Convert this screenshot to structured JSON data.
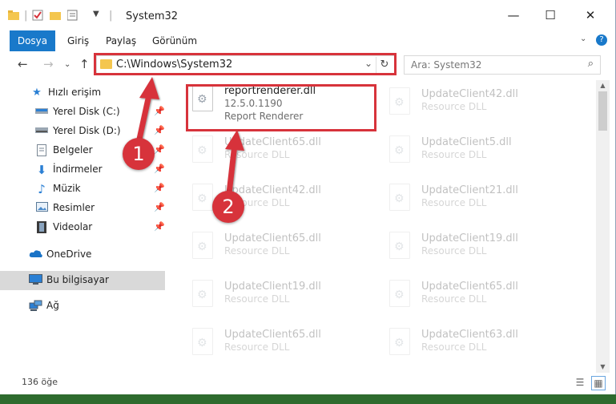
{
  "window": {
    "title": "System32",
    "controls": {
      "minimize": "—",
      "maximize": "☐",
      "close": "✕"
    }
  },
  "ribbon": {
    "tabs": [
      {
        "label": "Dosya"
      },
      {
        "label": "Giriş"
      },
      {
        "label": "Paylaş"
      },
      {
        "label": "Görünüm"
      }
    ]
  },
  "address": {
    "path": "C:\\Windows\\System32",
    "search_placeholder": "Ara: System32"
  },
  "sidebar": {
    "quick_access": "Hızlı erişim",
    "items": [
      {
        "label": "Yerel Disk (C:)"
      },
      {
        "label": "Yerel Disk (D:)"
      },
      {
        "label": "Belgeler"
      },
      {
        "label": "İndirmeler"
      },
      {
        "label": "Müzik"
      },
      {
        "label": "Resimler"
      },
      {
        "label": "Videolar"
      }
    ],
    "onedrive": "OneDrive",
    "this_pc": "Bu bilgisayar",
    "network": "Ağ"
  },
  "files": {
    "highlighted": {
      "name": "reportrenderer.dll",
      "version": "12.5.0.1190",
      "description": "Report Renderer"
    },
    "left": [
      {
        "name": "UpdateClient65.dll",
        "type": "Resource DLL"
      },
      {
        "name": "UpdateClient42.dll",
        "type": "Resource DLL"
      },
      {
        "name": "UpdateClient65.dll",
        "type": "Resource DLL"
      },
      {
        "name": "UpdateClient19.dll",
        "type": "Resource DLL"
      },
      {
        "name": "UpdateClient65.dll",
        "type": "Resource DLL"
      }
    ],
    "right": [
      {
        "name": "UpdateClient42.dll",
        "type": "Resource DLL"
      },
      {
        "name": "UpdateClient5.dll",
        "type": "Resource DLL"
      },
      {
        "name": "UpdateClient21.dll",
        "type": "Resource DLL"
      },
      {
        "name": "UpdateClient19.dll",
        "type": "Resource DLL"
      },
      {
        "name": "UpdateClient65.dll",
        "type": "Resource DLL"
      },
      {
        "name": "UpdateClient63.dll",
        "type": "Resource DLL"
      }
    ]
  },
  "status": {
    "count": "136 öğe"
  },
  "annotations": {
    "step1": "1",
    "step2": "2"
  },
  "colors": {
    "accent": "#1979ca",
    "highlight": "#d7333b",
    "folder": "#f4c64e"
  }
}
